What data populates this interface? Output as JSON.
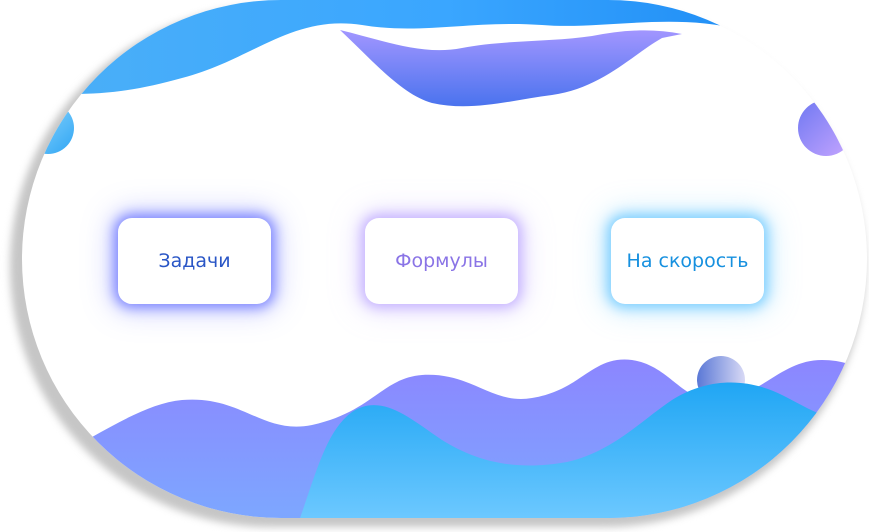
{
  "menu": {
    "buttons": [
      {
        "label": "Задачи",
        "color": "#2a56c6"
      },
      {
        "label": "Формулы",
        "color": "#8a74e6"
      },
      {
        "label": "На скорость",
        "color": "#1690df"
      }
    ]
  },
  "theme": {
    "wave_blue": "#1e96f0",
    "wave_purple": "#8c86ff",
    "wave_light_blue": "#6fc6ff"
  }
}
